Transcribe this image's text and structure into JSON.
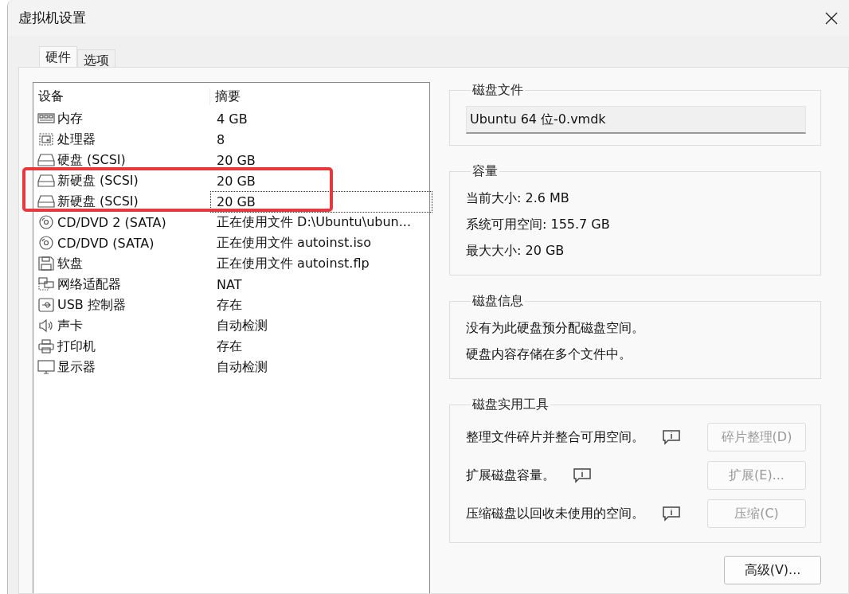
{
  "window": {
    "title": "虚拟机设置"
  },
  "tabs": [
    {
      "label": "硬件",
      "selected": true
    },
    {
      "label": "选项",
      "selected": false
    }
  ],
  "device_table": {
    "columns": [
      "设备",
      "摘要"
    ],
    "rows": [
      {
        "kind": "memory",
        "device": "内存",
        "summary": "4 GB",
        "selected": false,
        "annotated": false
      },
      {
        "kind": "cpu",
        "device": "处理器",
        "summary": "8",
        "selected": false,
        "annotated": false
      },
      {
        "kind": "disk",
        "device": "硬盘 (SCSI)",
        "summary": "20 GB",
        "selected": false,
        "annotated": false
      },
      {
        "kind": "disk",
        "device": "新硬盘 (SCSI)",
        "summary": "20 GB",
        "selected": false,
        "annotated": true
      },
      {
        "kind": "disk",
        "device": "新硬盘 (SCSI)",
        "summary": "20 GB",
        "selected": true,
        "annotated": true
      },
      {
        "kind": "cdrom",
        "device": "CD/DVD 2 (SATA)",
        "summary": "正在使用文件 D:\\Ubuntu\\ubun...",
        "selected": false,
        "annotated": false
      },
      {
        "kind": "cdrom",
        "device": "CD/DVD (SATA)",
        "summary": "正在使用文件 autoinst.iso",
        "selected": false,
        "annotated": false
      },
      {
        "kind": "floppy",
        "device": "软盘",
        "summary": "正在使用文件 autoinst.flp",
        "selected": false,
        "annotated": false
      },
      {
        "kind": "network",
        "device": "网络适配器",
        "summary": "NAT",
        "selected": false,
        "annotated": false
      },
      {
        "kind": "usb",
        "device": "USB 控制器",
        "summary": "存在",
        "selected": false,
        "annotated": false
      },
      {
        "kind": "sound",
        "device": "声卡",
        "summary": "自动检测",
        "selected": false,
        "annotated": false
      },
      {
        "kind": "printer",
        "device": "打印机",
        "summary": "存在",
        "selected": false,
        "annotated": false
      },
      {
        "kind": "display",
        "device": "显示器",
        "summary": "自动检测",
        "selected": false,
        "annotated": false
      }
    ]
  },
  "disk_file": {
    "legend": "磁盘文件",
    "value": "Ubuntu 64 位-0.vmdk"
  },
  "capacity": {
    "legend": "容量",
    "lines": [
      "当前大小: 2.6 MB",
      "系统可用空间: 155.7 GB",
      "最大大小: 20 GB"
    ]
  },
  "disk_info": {
    "legend": "磁盘信息",
    "lines": [
      "没有为此硬盘预分配磁盘空间。",
      "硬盘内容存储在多个文件中。"
    ]
  },
  "disk_utilities": {
    "legend": "磁盘实用工具",
    "items": [
      {
        "description": "整理文件碎片并整合可用空间。",
        "button": "碎片整理(D)",
        "disabled": true
      },
      {
        "description": "扩展磁盘容量。",
        "button": "扩展(E)...",
        "disabled": true
      },
      {
        "description": "压缩磁盘以回收未使用的空间。",
        "button": "压缩(C)",
        "disabled": true
      }
    ]
  },
  "advanced_button": {
    "label": "高级(V)...",
    "disabled": false
  }
}
